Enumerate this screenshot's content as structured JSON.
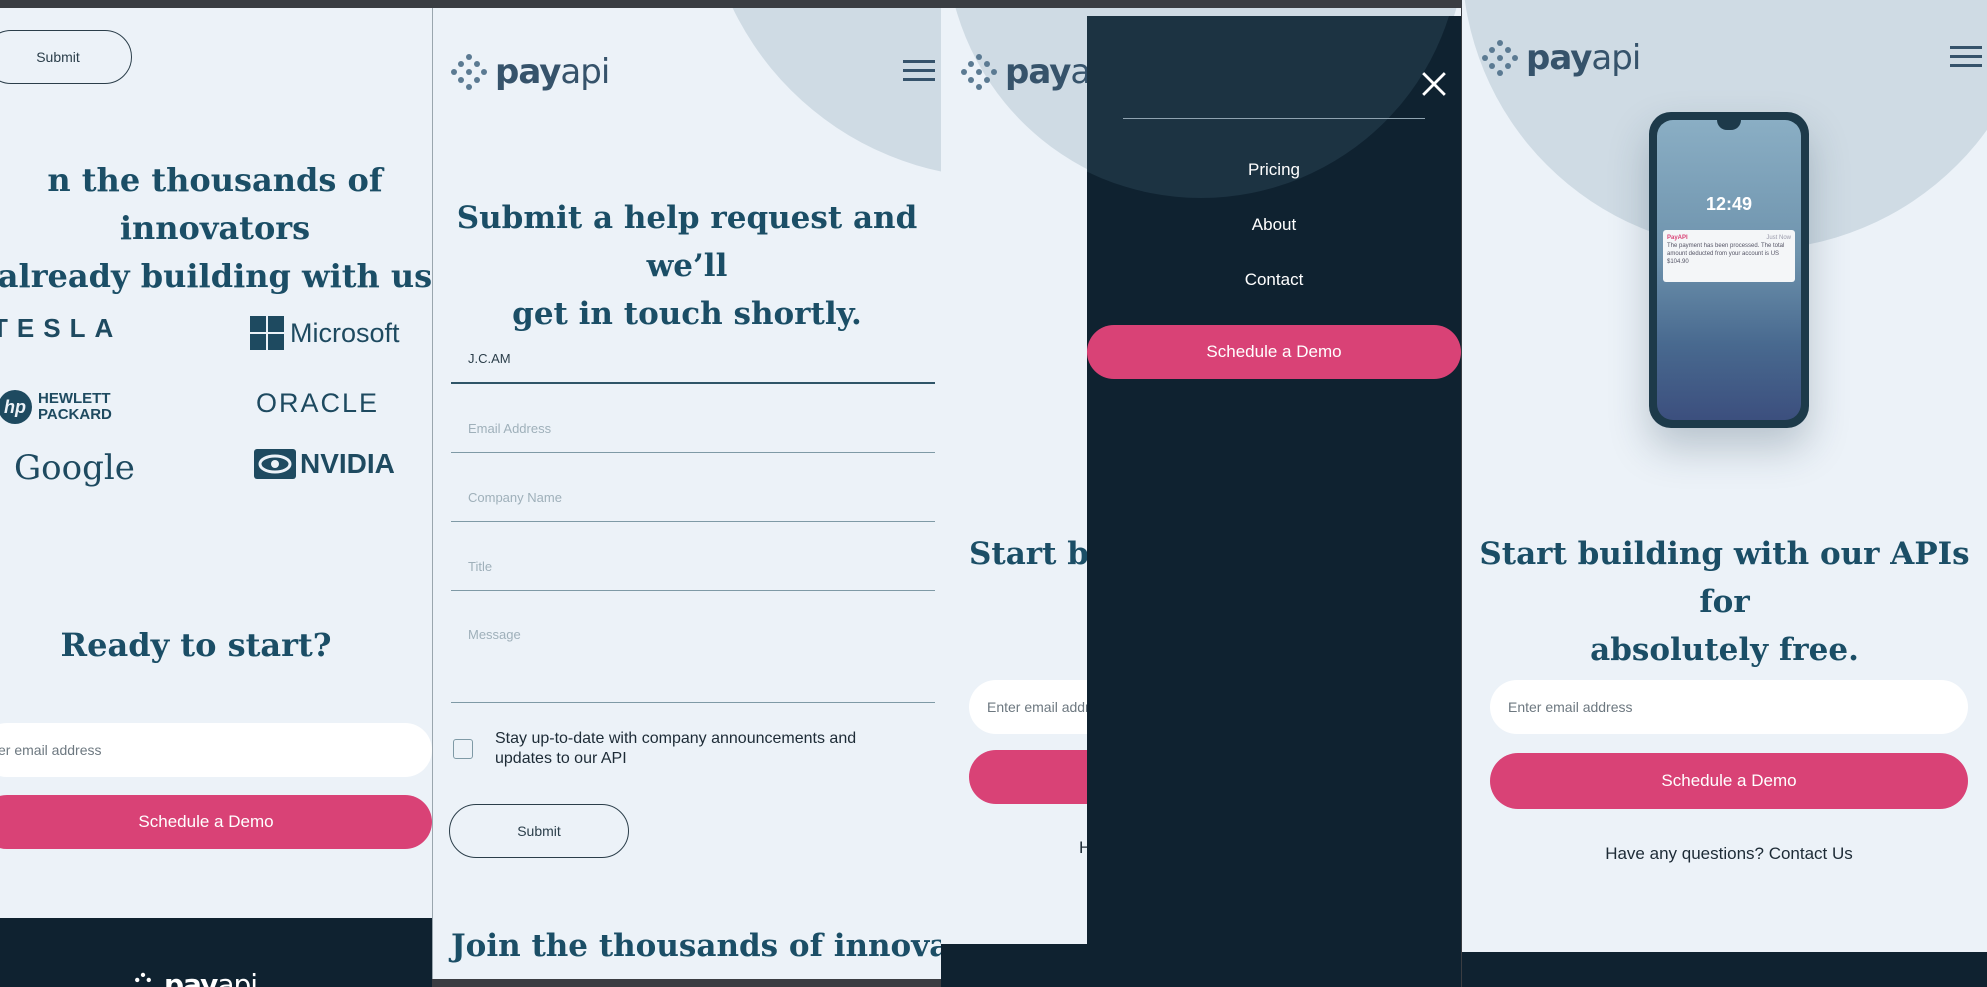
{
  "brand": {
    "name_bold": "pay",
    "name_light": "api"
  },
  "panel1": {
    "submit_label": "Submit",
    "heading_line1": "n the thousands of innovators",
    "heading_line2": "already building with us",
    "logos": [
      "TESLA",
      "Microsoft",
      "HEWLETT PACKARD",
      "ORACLE",
      "Google",
      "NVIDIA"
    ],
    "logo_hp_line1": "HEWLETT",
    "logo_hp_line2": "PACKARD",
    "logo_tesla": "TESLA",
    "logo_microsoft": "Microsoft",
    "logo_oracle": "ORACLE",
    "logo_google": "Google",
    "logo_nvidia": "NVIDIA",
    "ready_heading": "Ready to start?",
    "email_placeholder": "er email address",
    "demo_button": "Schedule a Demo"
  },
  "panel2": {
    "heading_line1": "Submit a help request and we’ll",
    "heading_line2": "get in touch shortly.",
    "name_value": "J.C.AM",
    "fields": [
      "Email Address",
      "Company Name",
      "Title",
      "Message"
    ],
    "checkbox_label_line1": "Stay up-to-date with company announcements and",
    "checkbox_label_line2": "updates to our API",
    "submit_label": "Submit",
    "join_heading": "Join the thousands of innovators"
  },
  "panel3": {
    "menu_items": [
      "Pricing",
      "About",
      "Contact"
    ],
    "demo_button": "Schedule a Demo",
    "heading_fragment": "Start bu",
    "email_fragment": "Enter email addr",
    "q_fragment": "H"
  },
  "panel4": {
    "phone_time": "12:49",
    "notif_app": "PayAPI",
    "notif_when": "Just Now",
    "notif_text": "The payment has been processed. The total amount deducted from your account is US $104.90",
    "heading_line1": "Start building with our APIs for",
    "heading_line2": "absolutely free.",
    "email_placeholder": "Enter email address",
    "demo_button": "Schedule a Demo",
    "questions": "Have any questions? Contact Us"
  },
  "colors": {
    "pink": "#d94276",
    "navy": "#0f2230",
    "teal": "#1b4e66",
    "bg": "#ecf2f8"
  }
}
